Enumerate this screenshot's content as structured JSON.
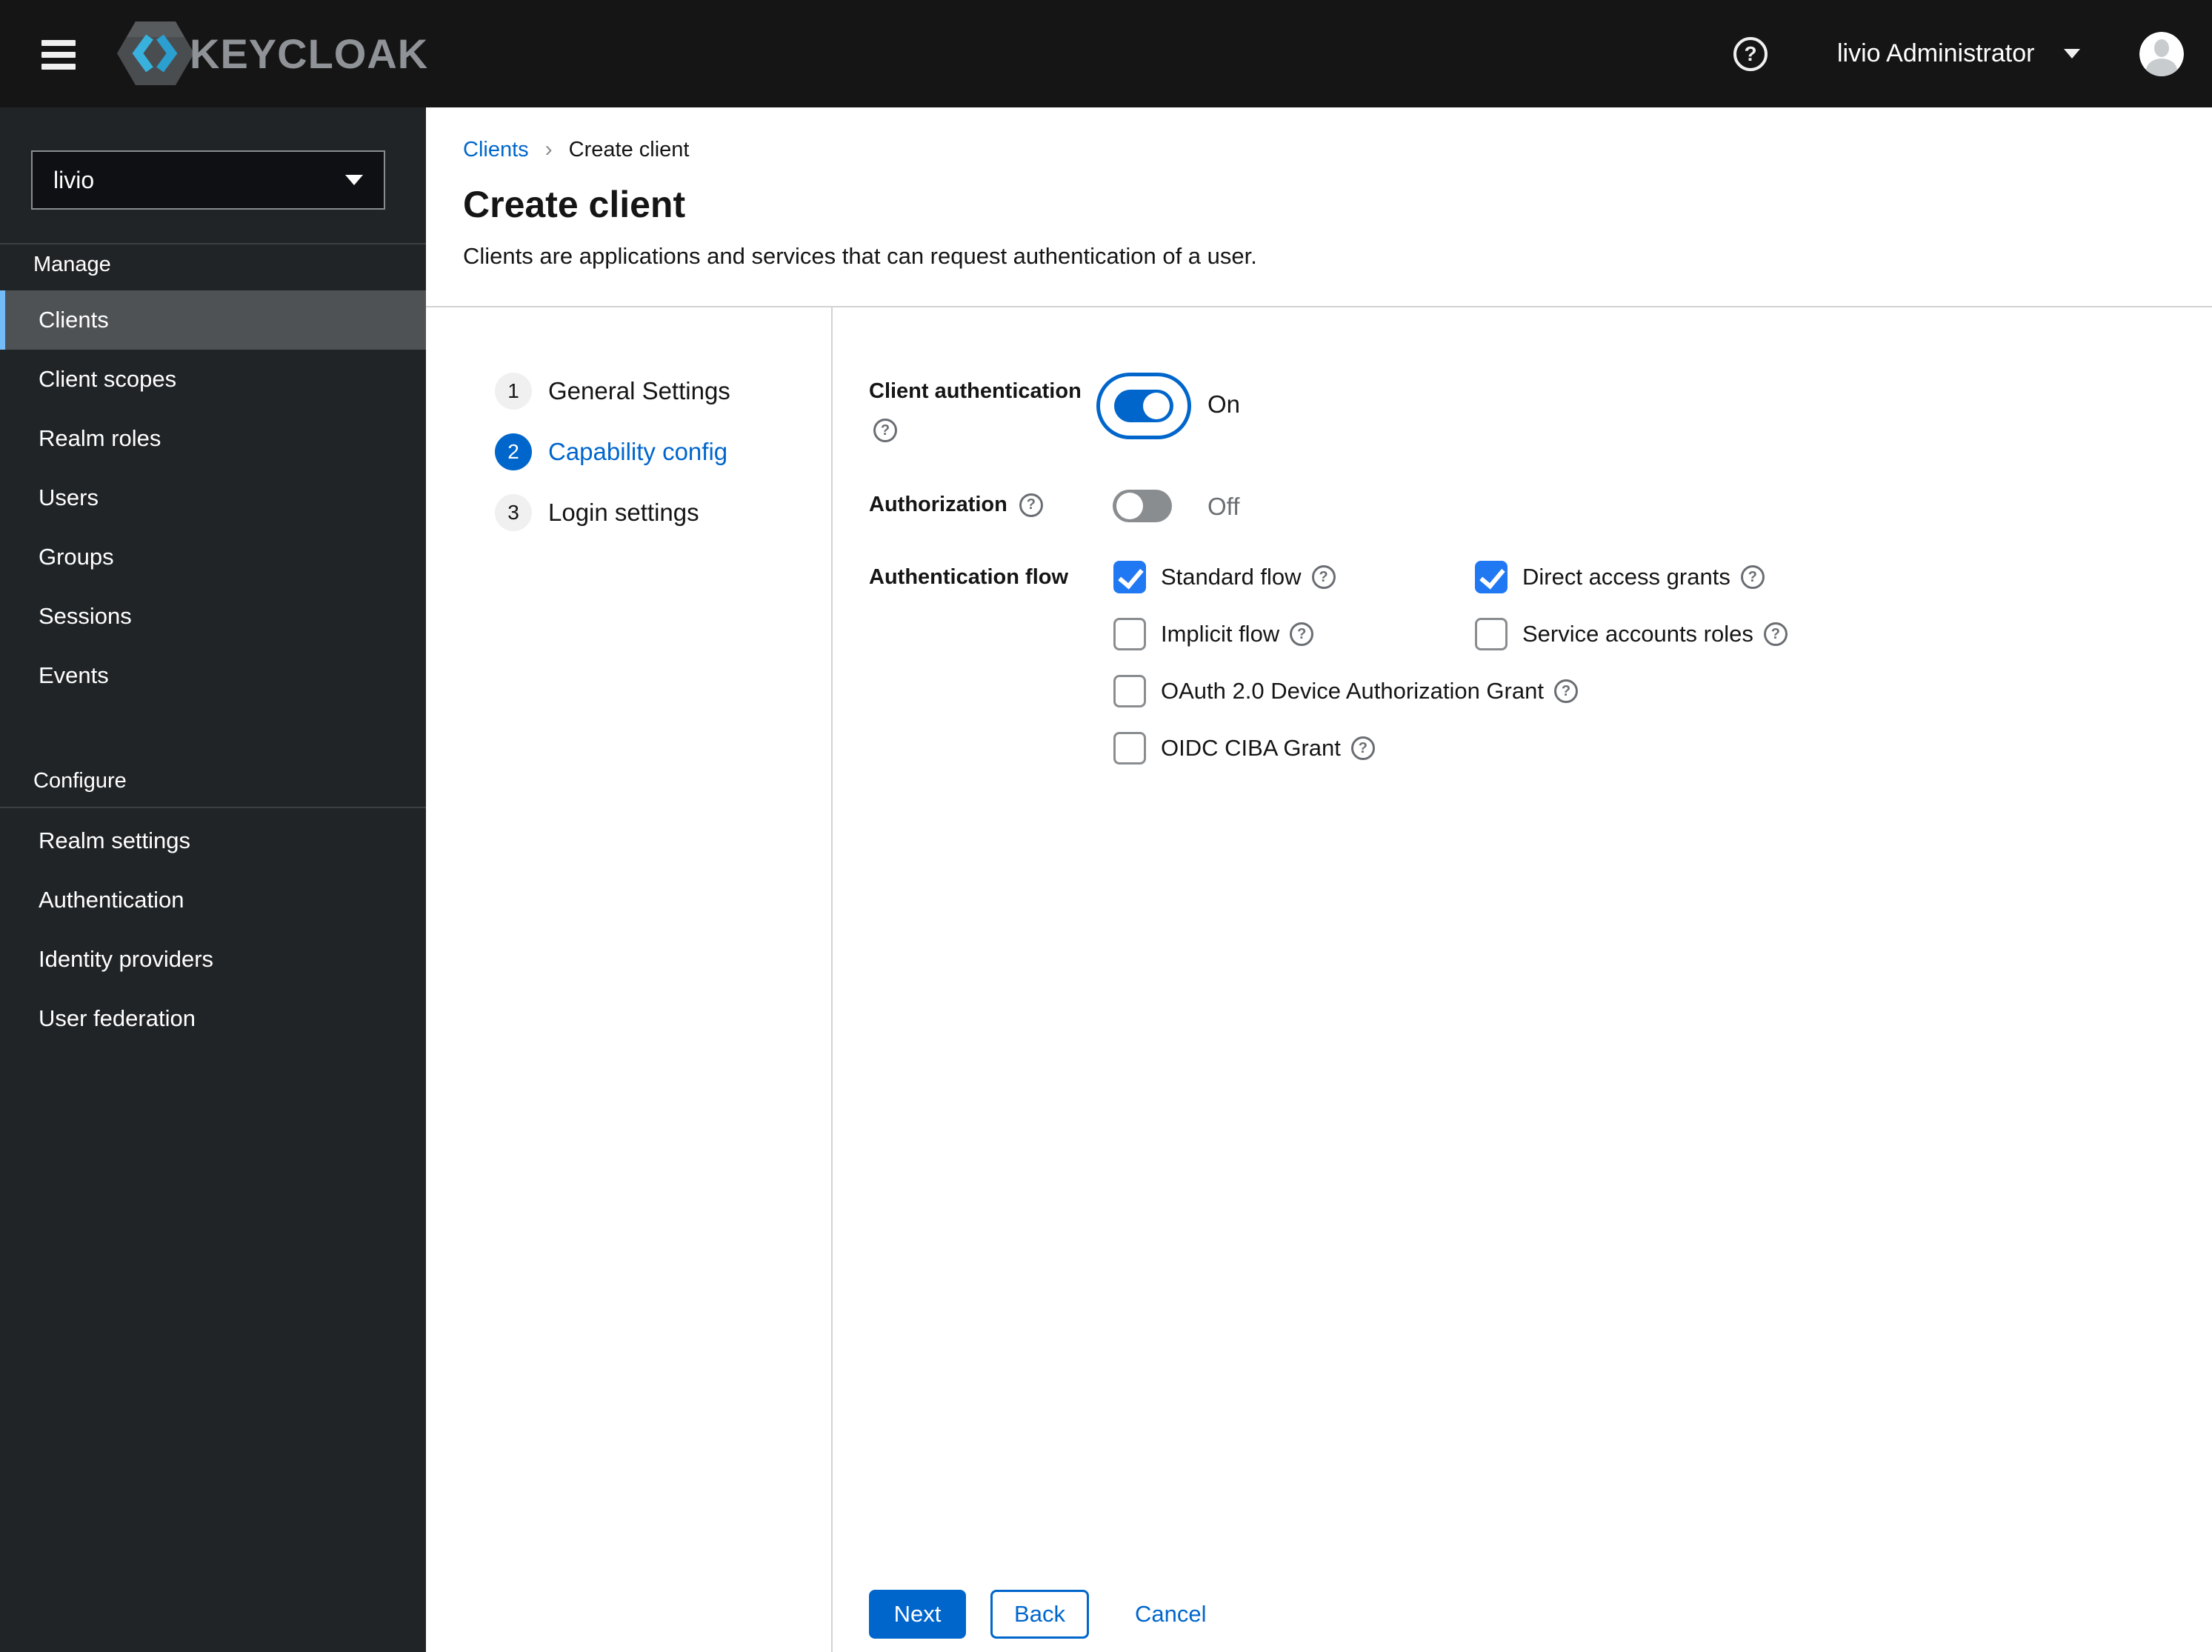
{
  "icons": {
    "help": "?"
  },
  "colors": {
    "accent": "#0066cc",
    "checkbox_checked": "#2178f3",
    "sidebar_active_border": "#73bcf7",
    "masthead_bg": "#151515",
    "sidebar_bg": "#212427"
  },
  "header": {
    "brand": "KEYCLOAK",
    "user_menu": {
      "label": "livio Administrator"
    }
  },
  "sidebar": {
    "realm_selector": {
      "value": "livio"
    },
    "sections": [
      {
        "label": "Manage",
        "items": [
          {
            "label": "Clients",
            "active": true
          },
          {
            "label": "Client scopes",
            "active": false
          },
          {
            "label": "Realm roles",
            "active": false
          },
          {
            "label": "Users",
            "active": false
          },
          {
            "label": "Groups",
            "active": false
          },
          {
            "label": "Sessions",
            "active": false
          },
          {
            "label": "Events",
            "active": false
          }
        ]
      },
      {
        "label": "Configure",
        "items": [
          {
            "label": "Realm settings",
            "active": false
          },
          {
            "label": "Authentication",
            "active": false
          },
          {
            "label": "Identity providers",
            "active": false
          },
          {
            "label": "User federation",
            "active": false
          }
        ]
      }
    ]
  },
  "main": {
    "breadcrumb": {
      "items": [
        "Clients",
        "Create client"
      ]
    },
    "page_title": "Create client",
    "page_subtitle": "Clients are applications and services that can request authentication of a user.",
    "wizard": {
      "steps": [
        {
          "number": "1",
          "label": "General Settings",
          "active": false
        },
        {
          "number": "2",
          "label": "Capability config",
          "active": true
        },
        {
          "number": "3",
          "label": "Login settings",
          "active": false
        }
      ]
    },
    "form": {
      "client_authentication": {
        "label": "Client authentication",
        "state": "On",
        "enabled": true
      },
      "authorization": {
        "label": "Authorization",
        "state": "Off",
        "enabled": false
      },
      "authentication_flow": {
        "label": "Authentication flow",
        "options": [
          {
            "label": "Standard flow",
            "checked": true
          },
          {
            "label": "Direct access grants",
            "checked": true
          },
          {
            "label": "Implicit flow",
            "checked": false
          },
          {
            "label": "Service accounts roles",
            "checked": false
          },
          {
            "label": "OAuth 2.0 Device Authorization Grant",
            "checked": false
          },
          {
            "label": "OIDC CIBA Grant",
            "checked": false
          }
        ]
      },
      "actions": {
        "next": "Next",
        "back": "Back",
        "cancel": "Cancel"
      }
    }
  }
}
